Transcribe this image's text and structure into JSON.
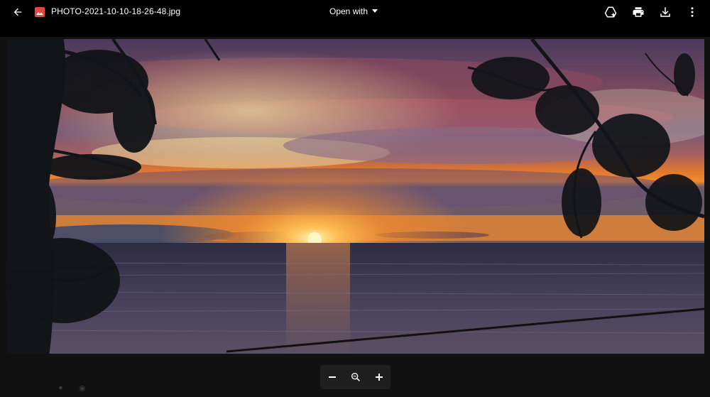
{
  "topbar": {
    "file_name": "PHOTO-2021-10-10-18-26-48.jpg",
    "open_with_label": "Open with",
    "icons": {
      "back": "arrow-back-icon",
      "file_type": "image-file-icon",
      "dropdown": "caret-down-icon",
      "add_to_drive": "add-to-drive-icon",
      "print": "print-icon",
      "download": "download-icon",
      "more": "more-vert-icon"
    }
  },
  "viewer": {
    "image_subject": "sunset over the sea framed by tree branches"
  },
  "zoom": {
    "icons": {
      "zoom_out": "minus-icon",
      "zoom_reset": "magnifier-icon",
      "zoom_in": "plus-icon"
    }
  },
  "colors": {
    "topbar_bg": "#000000",
    "file_icon": "#e8453c",
    "toolbar_bg": "#1f1f1f"
  }
}
